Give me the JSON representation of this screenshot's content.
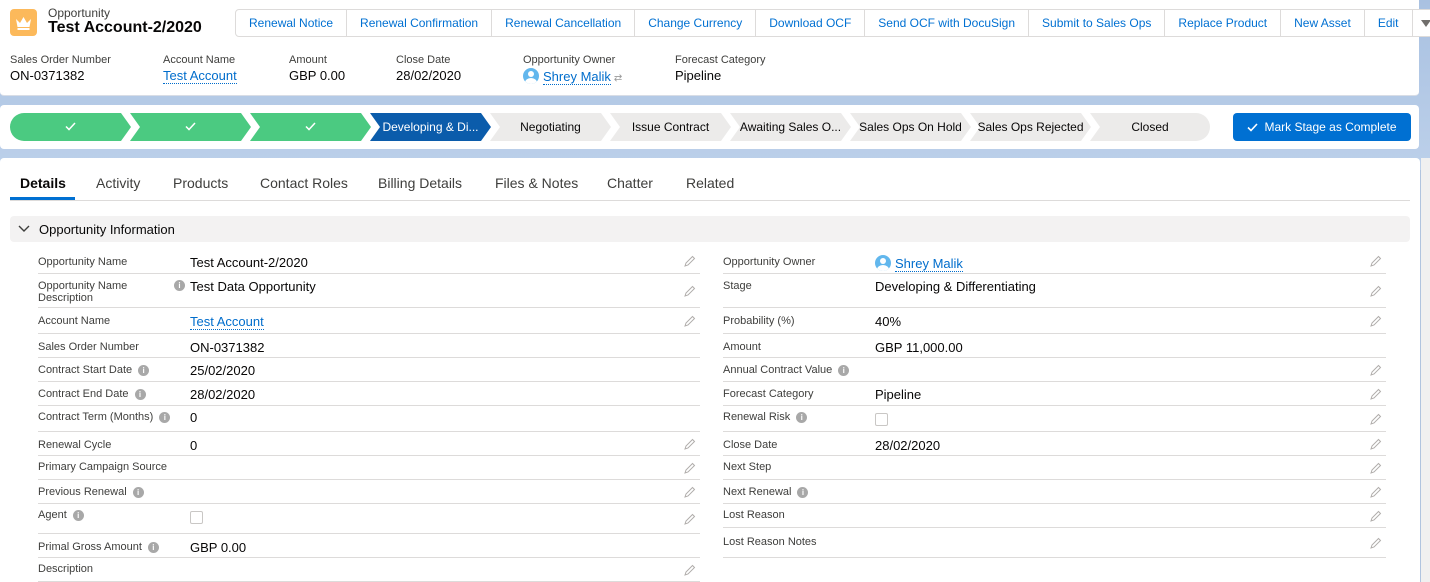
{
  "header": {
    "object_type": "Opportunity",
    "title": "Test Account-2/2020",
    "actions": [
      "Renewal Notice",
      "Renewal Confirmation",
      "Renewal Cancellation",
      "Change Currency",
      "Download OCF",
      "Send OCF with DocuSign",
      "Submit to Sales Ops",
      "Replace Product",
      "New Asset",
      "Edit"
    ],
    "highlights": {
      "sales_order_label": "Sales Order Number",
      "sales_order_value": "ON-0371382",
      "account_label": "Account Name",
      "account_value": "Test Account",
      "amount_label": "Amount",
      "amount_value": "GBP 0.00",
      "close_label": "Close Date",
      "close_value": "28/02/2020",
      "owner_label": "Opportunity Owner",
      "owner_value": "Shrey Malik",
      "forecast_label": "Forecast Category",
      "forecast_value": "Pipeline"
    }
  },
  "path": {
    "stages": [
      "",
      "",
      "",
      "Developing & Di...",
      "Negotiating",
      "Issue Contract",
      "Awaiting Sales O...",
      "Sales Ops On Hold",
      "Sales Ops Rejected",
      "Closed"
    ],
    "mark_complete_label": "Mark Stage as Complete"
  },
  "tabs": [
    "Details",
    "Activity",
    "Products",
    "Contact Roles",
    "Billing Details",
    "Files & Notes",
    "Chatter",
    "Related"
  ],
  "section_title": "Opportunity Information",
  "left_fields": [
    {
      "label": "Opportunity Name",
      "value": "Test Account-2/2020"
    },
    {
      "label": "Opportunity Name Description",
      "value": "Test Data Opportunity"
    },
    {
      "label": "Account Name",
      "value": "Test Account"
    },
    {
      "label": "Sales Order Number",
      "value": "ON-0371382"
    },
    {
      "label": "Contract Start Date",
      "value": "25/02/2020"
    },
    {
      "label": "Contract End Date",
      "value": "28/02/2020"
    },
    {
      "label": "Contract Term (Months)",
      "value": "0"
    },
    {
      "label": "Renewal Cycle",
      "value": "0"
    },
    {
      "label": "Primary Campaign Source",
      "value": ""
    },
    {
      "label": "Previous Renewal",
      "value": ""
    },
    {
      "label": "Agent",
      "value": ""
    },
    {
      "label": "Primal Gross Amount",
      "value": "GBP 0.00"
    },
    {
      "label": "Description",
      "value": ""
    }
  ],
  "right_fields": [
    {
      "label": "Opportunity Owner",
      "value": "Shrey Malik"
    },
    {
      "label": "Stage",
      "value": "Developing & Differentiating"
    },
    {
      "label": "Probability (%)",
      "value": "40%"
    },
    {
      "label": "Amount",
      "value": "GBP 11,000.00"
    },
    {
      "label": "Annual Contract Value",
      "value": ""
    },
    {
      "label": "Forecast Category",
      "value": "Pipeline"
    },
    {
      "label": "Renewal Risk",
      "value": ""
    },
    {
      "label": "Close Date",
      "value": "28/02/2020"
    },
    {
      "label": "Next Step",
      "value": ""
    },
    {
      "label": "Next Renewal",
      "value": ""
    },
    {
      "label": "Lost Reason",
      "value": ""
    },
    {
      "label": "Lost Reason Notes",
      "value": ""
    }
  ],
  "colors": {
    "brand": "#0070d2",
    "path_done": "#4bca81",
    "path_current": "#0b5cab",
    "path_todo": "#ecebea"
  }
}
